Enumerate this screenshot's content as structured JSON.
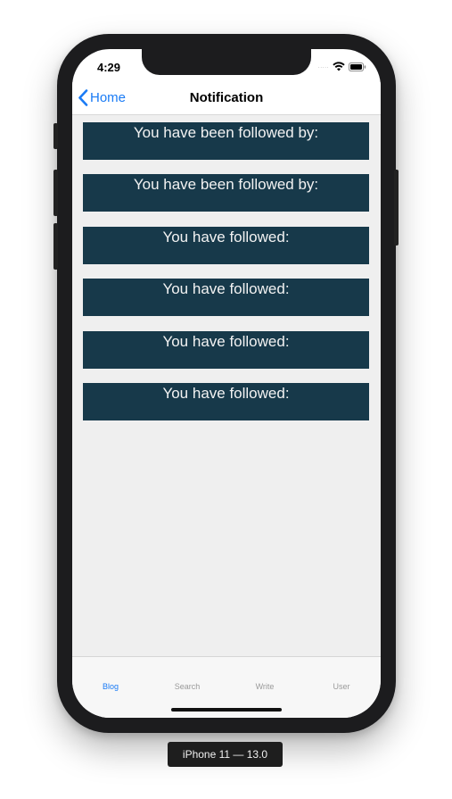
{
  "status_bar": {
    "time": "4:29",
    "signal": "....."
  },
  "nav": {
    "back_label": "Home",
    "title": "Notification"
  },
  "notifications": [
    {
      "text": "You have been followed by:"
    },
    {
      "text": "You have been followed by:"
    },
    {
      "text": "You have followed:"
    },
    {
      "text": "You have followed:"
    },
    {
      "text": "You have followed:"
    },
    {
      "text": "You have followed:"
    }
  ],
  "tabs": [
    {
      "label": "Blog",
      "active": true
    },
    {
      "label": "Search",
      "active": false
    },
    {
      "label": "Write",
      "active": false
    },
    {
      "label": "User",
      "active": false
    }
  ],
  "device_label": "iPhone 11 — 13.0",
  "colors": {
    "accent": "#1a7bf5",
    "card_background": "#17394a",
    "content_background": "#efefef"
  }
}
